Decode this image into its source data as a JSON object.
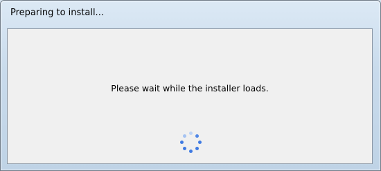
{
  "window": {
    "title": "Preparing to install..."
  },
  "body": {
    "message": "Please wait while the installer loads."
  },
  "spinner": {
    "icon": "loading-spinner-icon",
    "colors": [
      "#bcd3f5",
      "#4f86e6",
      "#3f7ae2",
      "#3f7ae2",
      "#3f7ae2",
      "#3f7ae2",
      "#3f7ae2",
      "#a5c3f2"
    ]
  }
}
